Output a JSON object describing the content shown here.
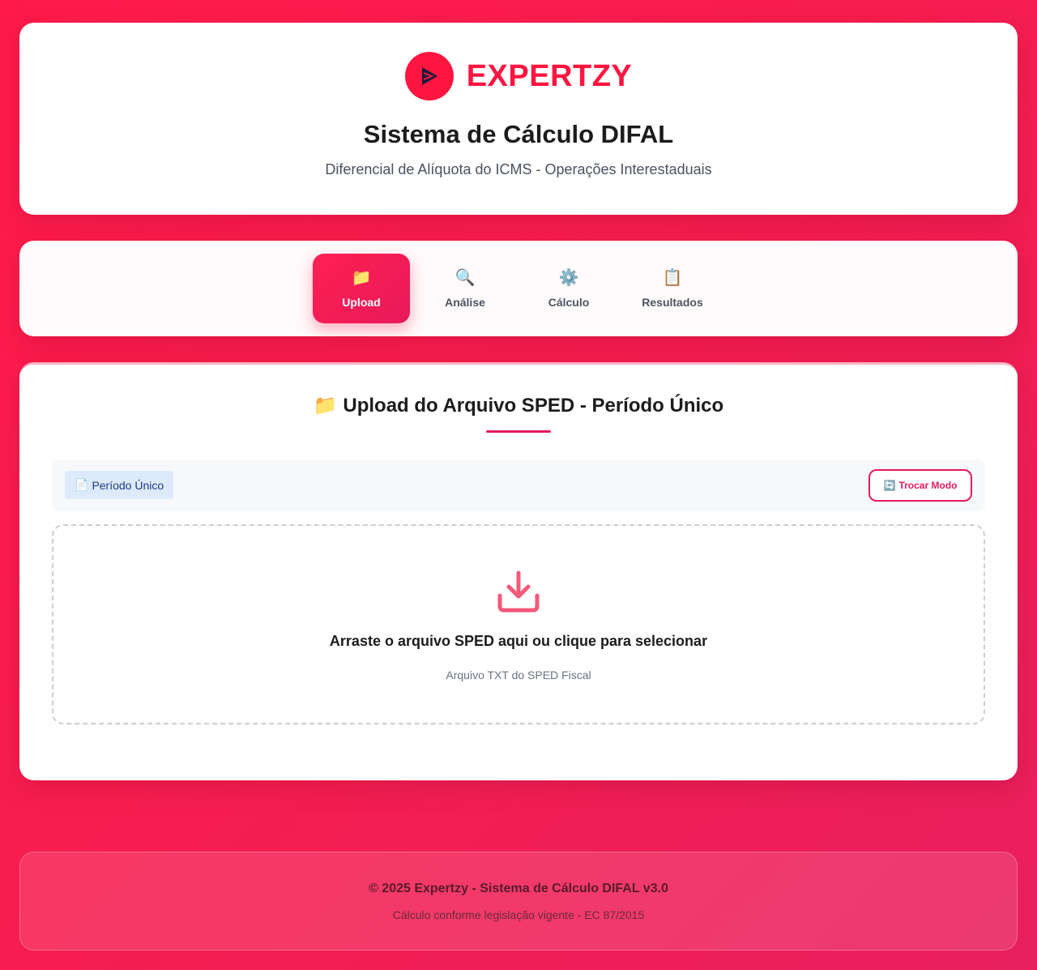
{
  "header": {
    "brand_name": "EXPERTZY",
    "title": "Sistema de Cálculo DIFAL",
    "subtitle": "Diferencial de Alíquota do ICMS - Operações Interestaduais"
  },
  "nav": {
    "steps": [
      {
        "label": "Upload",
        "icon": "📁",
        "icon_name": "folder-icon",
        "active": true
      },
      {
        "label": "Análise",
        "icon": "🔍",
        "icon_name": "magnifier-icon",
        "active": false
      },
      {
        "label": "Cálculo",
        "icon": "⚙️",
        "icon_name": "gear-icon",
        "active": false
      },
      {
        "label": "Resultados",
        "icon": "📋",
        "icon_name": "clipboard-icon",
        "active": false
      }
    ]
  },
  "main": {
    "title_icon": "📁",
    "title": "Upload do Arquivo SPED - Período Único",
    "mode_badge": {
      "icon": "📄",
      "label": "Período Único"
    },
    "switch_button": {
      "icon": "🔄",
      "label": "Trocar Modo"
    },
    "dropzone": {
      "title": "Arraste o arquivo SPED aqui ou clique para selecionar",
      "hint": "Arquivo TXT do SPED Fiscal"
    }
  },
  "footer": {
    "main": "© 2025 Expertzy - Sistema de Cálculo DIFAL v3.0",
    "sub": "Cálculo conforme legislação vigente - EC 87/2015"
  },
  "colors": {
    "brand": "#ff1640",
    "accent": "#e8195a",
    "badge_bg": "#dceafc",
    "badge_text": "#1e3a8a"
  }
}
